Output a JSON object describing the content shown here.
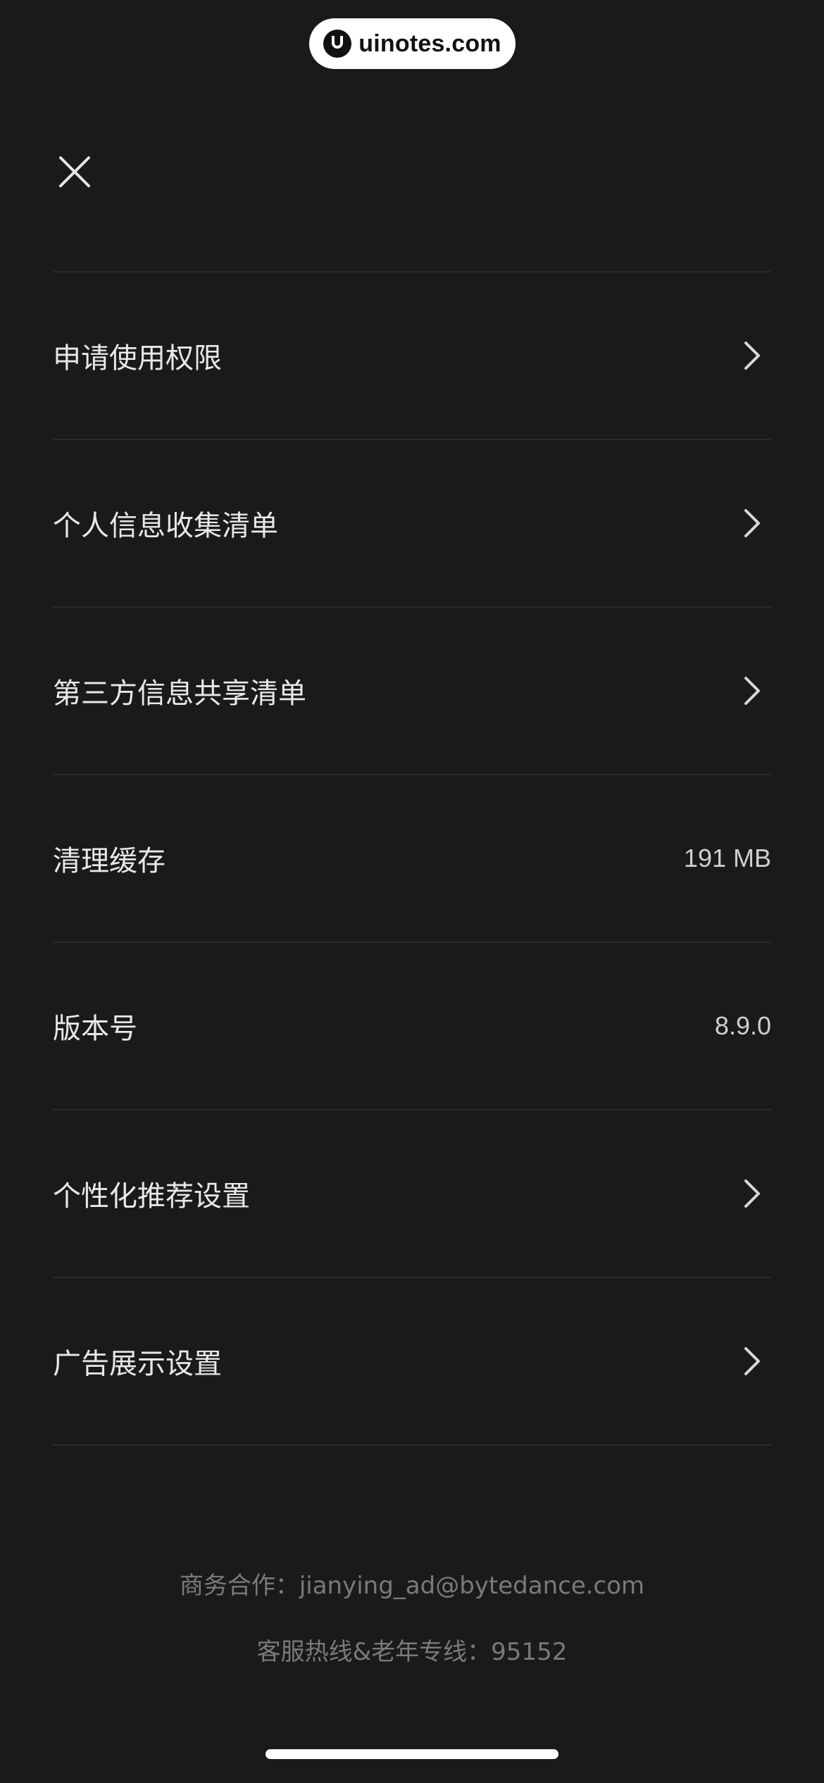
{
  "watermark": {
    "text": "uinotes.com",
    "logo_icon": "uinotes-logo"
  },
  "header": {
    "close_icon": "close-icon"
  },
  "settings": {
    "items": [
      {
        "label": "申请使用权限",
        "icon": "chevron-right-icon"
      },
      {
        "label": "个人信息收集清单",
        "icon": "chevron-right-icon"
      },
      {
        "label": "第三方信息共享清单",
        "icon": "chevron-right-icon"
      },
      {
        "label": "清理缓存",
        "value": "191 MB"
      },
      {
        "label": "版本号",
        "value": "8.9.0"
      },
      {
        "label": "个性化推荐设置",
        "icon": "chevron-right-icon"
      },
      {
        "label": "广告展示设置",
        "icon": "chevron-right-icon"
      }
    ]
  },
  "footer": {
    "business": "商务合作：jianying_ad@bytedance.com",
    "hotline": "客服热线&老年专线：95152"
  },
  "colors": {
    "background": "#1a1a1a",
    "text_primary": "#e8e8e8",
    "text_secondary": "#7a7a7a",
    "divider": "#2b2b2b"
  }
}
